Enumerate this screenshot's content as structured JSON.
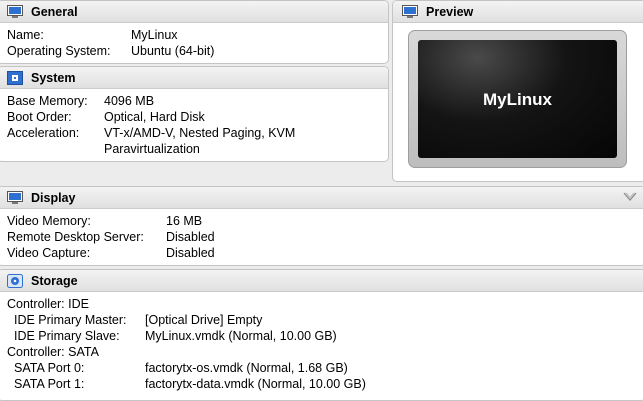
{
  "general": {
    "title": "General",
    "rows": [
      {
        "label": "Name:",
        "value": "MyLinux"
      },
      {
        "label": "Operating System:",
        "value": "Ubuntu (64-bit)"
      }
    ]
  },
  "system": {
    "title": "System",
    "rows": [
      {
        "label": "Base Memory:",
        "value": "4096 MB"
      },
      {
        "label": "Boot Order:",
        "value": "Optical, Hard Disk"
      },
      {
        "label": "Acceleration:",
        "value": "VT-x/AMD-V, Nested Paging, KVM",
        "value2": "Paravirtualization"
      }
    ]
  },
  "preview": {
    "title": "Preview",
    "screen_text": "MyLinux"
  },
  "display": {
    "title": "Display",
    "rows": [
      {
        "label": "Video Memory:",
        "value": "16 MB"
      },
      {
        "label": "Remote Desktop Server:",
        "value": "Disabled"
      },
      {
        "label": "Video Capture:",
        "value": "Disabled"
      }
    ]
  },
  "storage": {
    "title": "Storage",
    "controller_ide": "Controller: IDE",
    "ide_rows": [
      {
        "label": "IDE Primary Master:",
        "value": "[Optical Drive] Empty"
      },
      {
        "label": "IDE Primary Slave:",
        "value": "MyLinux.vmdk (Normal, 10.00 GB)"
      }
    ],
    "controller_sata": "Controller: SATA",
    "sata_rows": [
      {
        "label": "SATA Port 0:",
        "value": "factorytx-os.vmdk (Normal, 1.68 GB)"
      },
      {
        "label": "SATA Port 1:",
        "value": "factorytx-data.vmdk (Normal, 10.00 GB)"
      }
    ]
  },
  "icons": {
    "general": "general-monitor-icon",
    "system": "system-chip-icon",
    "preview": "preview-monitor-icon",
    "display": "display-monitor-icon",
    "storage": "storage-disk-icon",
    "collapse": "chevron-down-icon"
  },
  "colors": {
    "accent_blue": "#2f6fd0",
    "panel_header": "#e6e6e6",
    "preview_screen": "#0b0b0b"
  }
}
